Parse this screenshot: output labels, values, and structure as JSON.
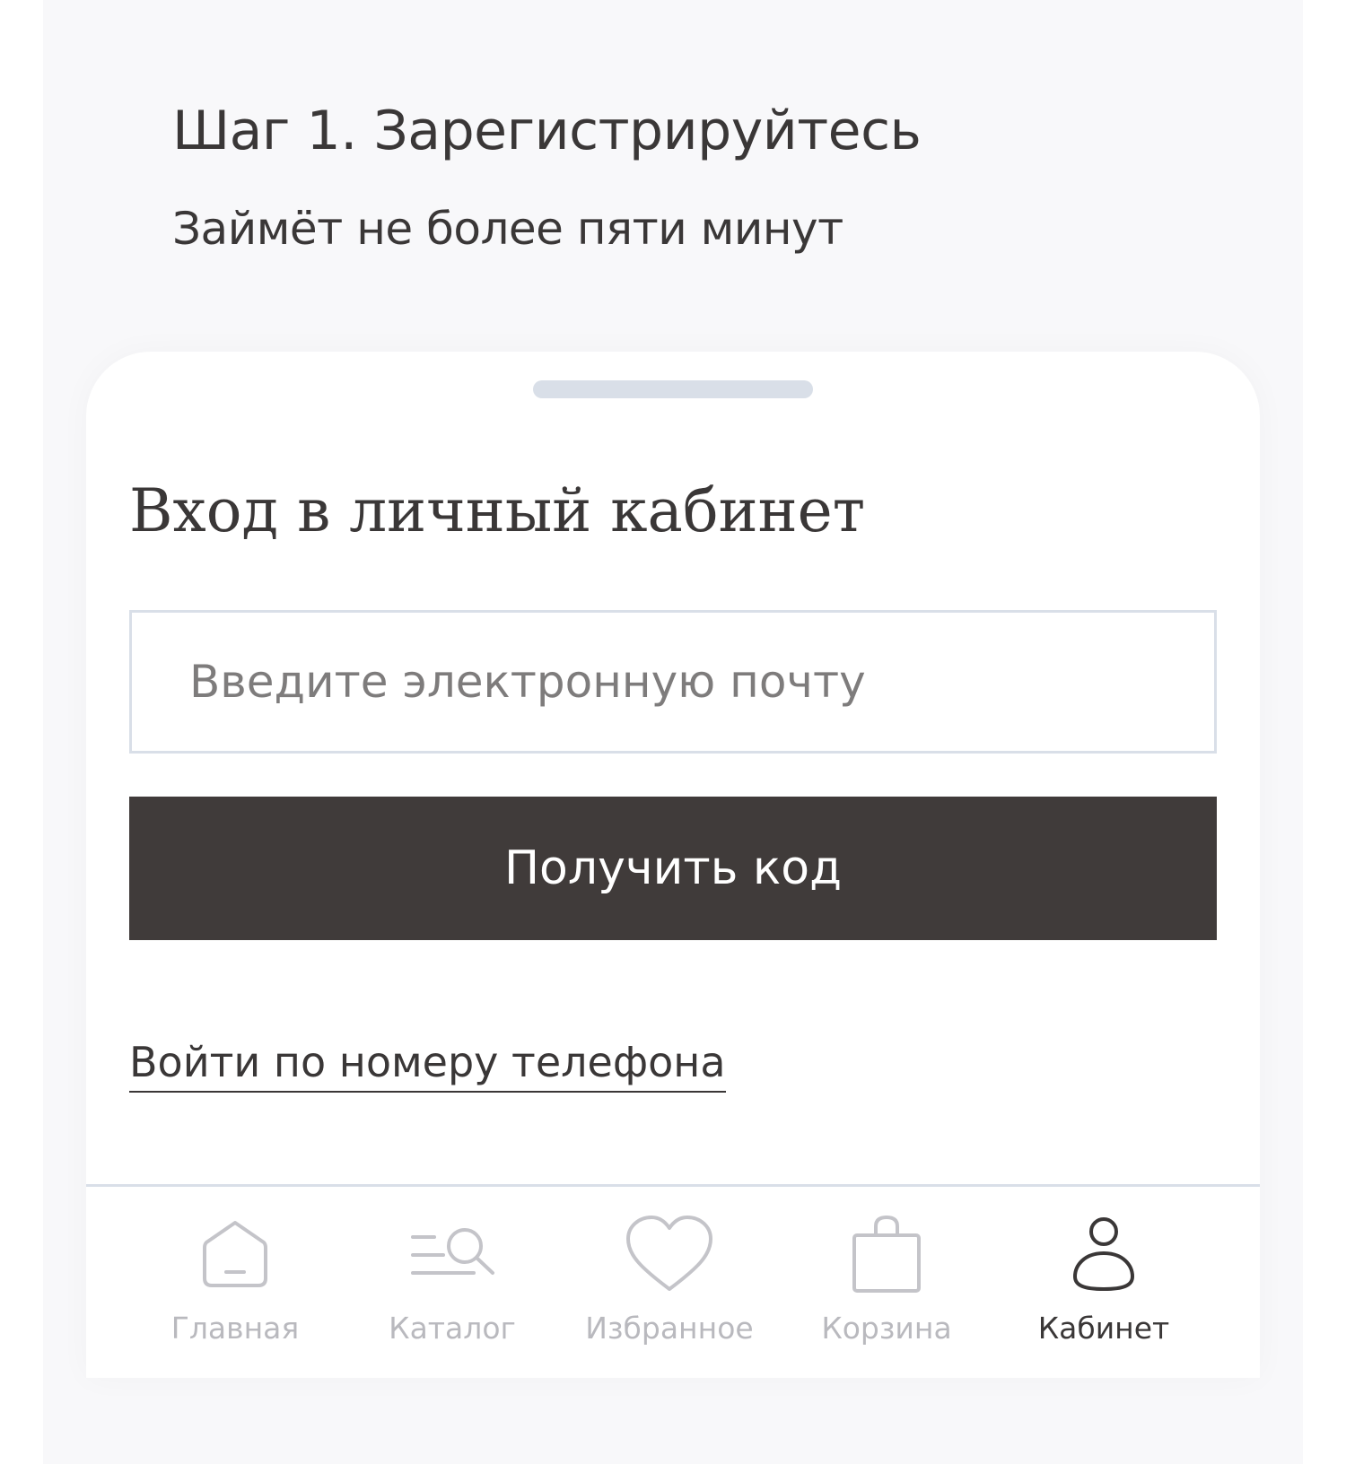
{
  "header": {
    "step_title": "Шаг 1. Зарегистрируйтесь",
    "step_subtitle": "Займёт не более пяти минут"
  },
  "login": {
    "title": "Вход в личный кабинет",
    "email_placeholder": "Введите электронную почту",
    "email_value": "",
    "submit_label": "Получить код",
    "phone_link_label": "Войти по номеру телефона"
  },
  "tabbar": {
    "items": [
      {
        "label": "Главная",
        "icon": "home-icon",
        "active": false
      },
      {
        "label": "Каталог",
        "icon": "catalog-search-icon",
        "active": false
      },
      {
        "label": "Избранное",
        "icon": "heart-icon",
        "active": false
      },
      {
        "label": "Корзина",
        "icon": "shopping-bag-icon",
        "active": false
      },
      {
        "label": "Кабинет",
        "icon": "user-icon",
        "active": true
      }
    ]
  },
  "colors": {
    "background": "#f8f8fa",
    "card": "#ffffff",
    "primary_button": "#403b3a",
    "text": "#3a3737",
    "border": "#d9dfe8",
    "inactive_tab": "#b9b9be"
  }
}
